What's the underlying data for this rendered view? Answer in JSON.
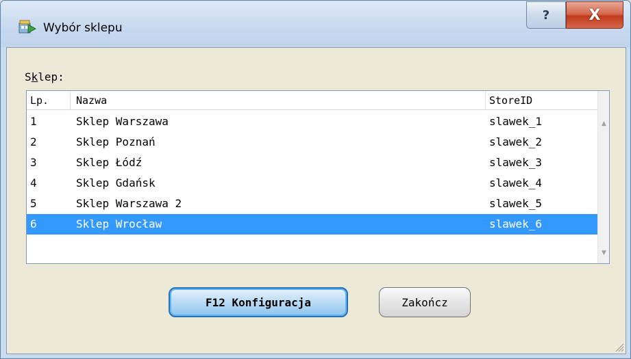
{
  "window": {
    "title": "Wybór sklepu",
    "help_glyph": "?",
    "close_glyph": "X",
    "app_icon": "shop-icon"
  },
  "form": {
    "store_label_prefix": "S",
    "store_label_mnemonic": "k",
    "store_label_suffix": "lep:"
  },
  "list": {
    "columns": [
      "Lp.",
      "Nazwa",
      "StoreID"
    ],
    "rows": [
      {
        "lp": "1",
        "name": "Sklep Warszawa",
        "store_id": "slawek_1"
      },
      {
        "lp": "2",
        "name": "Sklep Poznań",
        "store_id": "slawek_2"
      },
      {
        "lp": "3",
        "name": "Sklep Łódź",
        "store_id": "slawek_3"
      },
      {
        "lp": "4",
        "name": "Sklep Gdańsk",
        "store_id": "slawek_4"
      },
      {
        "lp": "5",
        "name": "Sklep Warszawa 2",
        "store_id": "slawek_5"
      },
      {
        "lp": "6",
        "name": "Sklep Wrocław",
        "store_id": "slawek_6"
      }
    ],
    "selected_row": "6",
    "selection_color": "#3399ff"
  },
  "buttons": {
    "config_label": "F12 Konfiguracja",
    "close_label": "Zakończ"
  },
  "colors": {
    "accent": "#3399ff",
    "close_button": "#c1391c"
  }
}
